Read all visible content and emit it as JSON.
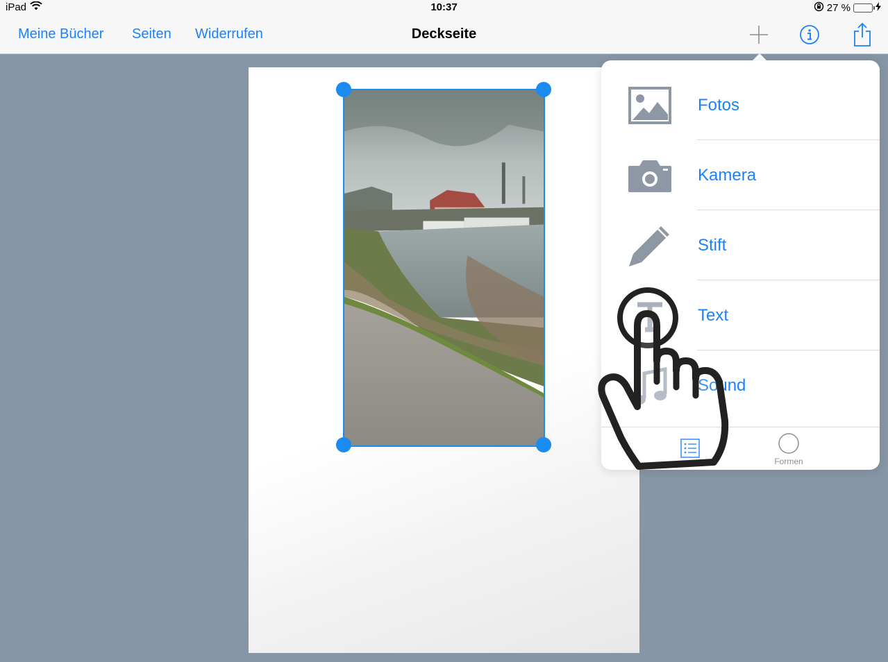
{
  "status": {
    "device": "iPad",
    "time": "10:37",
    "battery": "27 %",
    "battery_level": 0.27
  },
  "nav": {
    "left": [
      "Meine Bücher",
      "Seiten",
      "Widerrufen"
    ],
    "title": "Deckseite",
    "icons": [
      "plus-icon",
      "info-icon",
      "share-icon"
    ]
  },
  "menu": {
    "items": [
      {
        "label": "Fotos",
        "icon": "photos-icon"
      },
      {
        "label": "Kamera",
        "icon": "camera-icon"
      },
      {
        "label": "Stift",
        "icon": "pen-icon"
      },
      {
        "label": "Text",
        "icon": "text-icon"
      },
      {
        "label": "Sound",
        "icon": "music-note-icon"
      }
    ],
    "tabs": [
      {
        "label": "",
        "icon": "list-icon",
        "selected": true
      },
      {
        "label": "Formen",
        "icon": "circle-icon",
        "selected": false
      }
    ]
  },
  "colors": {
    "accent": "#1a82fb",
    "background": "#8796a6",
    "selection": "#1b8bf0"
  }
}
